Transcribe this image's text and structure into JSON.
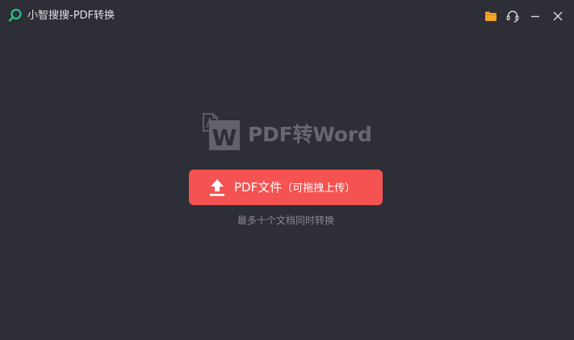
{
  "titlebar": {
    "title": "小智搜搜-PDF转换",
    "icons": {
      "app": "search-logo-icon",
      "folder": "folder-icon",
      "support": "headset-icon",
      "minimize": "minimize-icon",
      "close": "close-icon"
    }
  },
  "hero": {
    "doc_letter": "W",
    "title": "PDF转Word"
  },
  "upload": {
    "label": "PDF文件",
    "note": "（可拖拽上传）",
    "hint": "最多十个文档同时转换"
  },
  "colors": {
    "background": "#2e2e36",
    "accent": "#f55252",
    "logo": "#2bc48a",
    "folder": "#f5a623"
  }
}
